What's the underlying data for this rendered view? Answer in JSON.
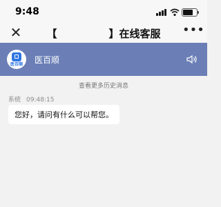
{
  "status_bar": {
    "time": "9:48",
    "battery_level": 0.85,
    "icons": [
      "signal-icon",
      "wifi-icon",
      "battery-icon"
    ]
  },
  "nav": {
    "close_icon": "close-icon",
    "title": "【　　　　　】在线客服",
    "more_icon": "more-icon"
  },
  "banner": {
    "logo_text": "医百顺",
    "name": "医百顺",
    "speaker_icon": "speaker-icon",
    "color": "#6b7fb6"
  },
  "chat": {
    "history_link": "查看更多历史消息",
    "messages": [
      {
        "sender": "系统",
        "time": "09:48:15",
        "text": "您好，请问有什么可以帮您。"
      }
    ]
  }
}
